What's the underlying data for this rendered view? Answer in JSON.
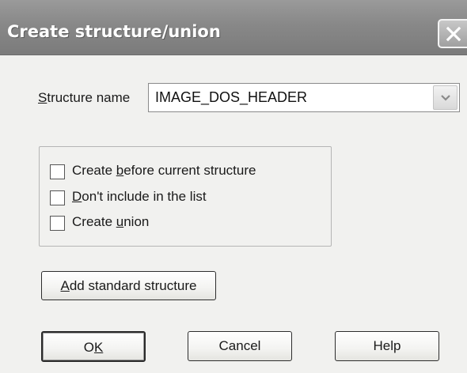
{
  "window": {
    "title": "Create structure/union"
  },
  "structure_name": {
    "label_first": "S",
    "label_rest": "tructure name",
    "value": "IMAGE_DOS_HEADER"
  },
  "options": [
    {
      "pre": "Create ",
      "acc": "b",
      "post": "efore current structure",
      "checked": false
    },
    {
      "pre": "",
      "acc": "D",
      "post": "on't include in the list",
      "checked": false
    },
    {
      "pre": "Create ",
      "acc": "u",
      "post": "nion",
      "checked": false
    }
  ],
  "buttons": {
    "add_standard": {
      "acc": "A",
      "rest": "dd standard structure"
    },
    "ok": {
      "pre": "O",
      "acc": "K"
    },
    "cancel": "Cancel",
    "help": "Help"
  },
  "icons": {
    "close": "close-icon",
    "dropdown": "chevron-down-icon"
  }
}
